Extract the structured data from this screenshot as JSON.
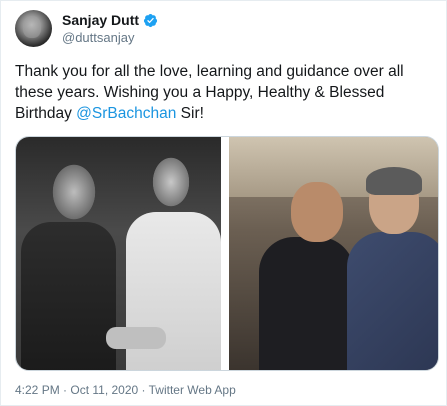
{
  "user": {
    "display_name": "Sanjay Dutt",
    "handle": "@duttsanjay",
    "verified": true,
    "verified_icon": "verified-badge-icon",
    "verified_color": "#1da1f2"
  },
  "tweet": {
    "text_before": "Thank you for all the love, learning and guidance over all these years. Wishing you a Happy, Healthy & Blessed Birthday ",
    "mention": "@SrBachchan",
    "text_after": " Sir!",
    "mention_color": "#1b95e0"
  },
  "meta": {
    "timestamp": "4:22 PM · Oct 11, 2020 · Twitter Web App"
  }
}
